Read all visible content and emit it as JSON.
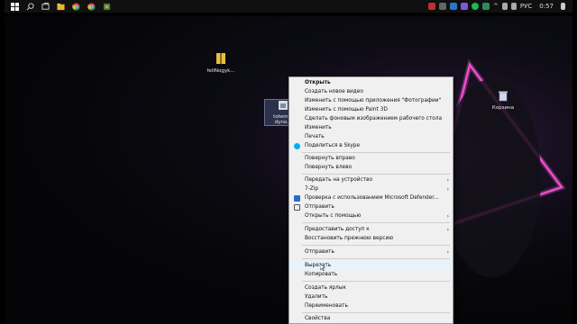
{
  "taskbar": {
    "icons": [
      "windows-logo",
      "search-icon",
      "task-view-icon",
      "file-explorer-icon",
      "chrome-icon",
      "chrome-icon",
      "app-icon"
    ],
    "tray_lang": "РУС",
    "clock": "0:57"
  },
  "desktop": {
    "icons": [
      {
        "name": "archive-file",
        "label": "fellNogyk..."
      },
      {
        "name": "selected-file",
        "label": "totem... dyno..."
      },
      {
        "name": "recycle-bin",
        "label": "Корзина"
      }
    ]
  },
  "menu": {
    "items": [
      {
        "label": "Открыть",
        "bold": true
      },
      {
        "label": "Создать новое видео"
      },
      {
        "label": "Изменить с помощью приложения \"Фотографии\""
      },
      {
        "label": "Изменить с помощью Paint 3D"
      },
      {
        "label": "Сделать фоновым изображением рабочего стола"
      },
      {
        "label": "Изменить"
      },
      {
        "label": "Печать"
      },
      {
        "label": "Поделиться в Skype",
        "icon": "skype-icon"
      },
      {
        "label": "Повернуть вправо"
      },
      {
        "label": "Повернуть влево"
      },
      {
        "label": "Передать на устройство",
        "submenu": true
      },
      {
        "label": "7-Zip",
        "submenu": true
      },
      {
        "label": "Проверка с использованием Microsoft Defender...",
        "icon": "defender-icon"
      },
      {
        "label": "Отправить",
        "icon": "share-icon"
      },
      {
        "label": "Открыть с помощью",
        "submenu": true
      },
      {
        "label": "Предоставить доступ к",
        "submenu": true
      },
      {
        "label": "Восстановить прежнюю версию"
      },
      {
        "label": "Отправить",
        "submenu": true
      },
      {
        "label": "Вырезать"
      },
      {
        "label": "Копировать"
      },
      {
        "label": "Создать ярлык"
      },
      {
        "label": "Удалить"
      },
      {
        "label": "Переименовать"
      },
      {
        "label": "Свойства"
      }
    ]
  }
}
